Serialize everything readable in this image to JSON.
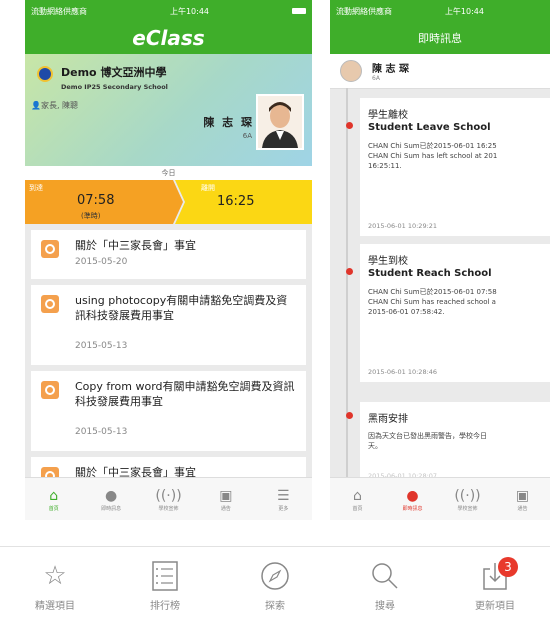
{
  "phone1": {
    "status": {
      "carrier": "流動網絡供應商",
      "time": "上午10:44"
    },
    "app_title": "eClass",
    "school": {
      "name_zh": "Demo 博文亞洲中學",
      "name_en": "Demo IP25 Secondary School"
    },
    "parent_label": "家長, 陳聰",
    "student": {
      "name": "陳 志 琛",
      "class": "6A"
    },
    "attendance": {
      "date_label": "今日",
      "arrive_label": "到達",
      "arrive_time": "07:58",
      "arrive_note": "(準時)",
      "leave_label": "離開",
      "leave_time": "16:25"
    },
    "notices": [
      {
        "title": "關於「中三家長會」事宜",
        "date": "2015-05-20"
      },
      {
        "title": "using photocopy有關申請豁免空調費及資訊科技發展費用事宜",
        "date": "2015-05-13"
      },
      {
        "title": "Copy from word有關申請豁免空調費及資訊科技發展費用事宜",
        "date": "2015-05-13"
      },
      {
        "title": "關於「中三家長會」事宜",
        "date": ""
      }
    ],
    "tabs": [
      {
        "label": "首頁",
        "icon": "home-icon"
      },
      {
        "label": "即時訊息",
        "icon": "chat-icon"
      },
      {
        "label": "學校宣佈",
        "icon": "broadcast-icon"
      },
      {
        "label": "通告",
        "icon": "notice-icon"
      },
      {
        "label": "更多",
        "icon": "menu-icon"
      }
    ]
  },
  "phone2": {
    "status": {
      "carrier": "流動網絡供應商",
      "time": "上午10:44"
    },
    "title": "即時訊息",
    "user": {
      "name": "陳 志 琛",
      "class": "6A"
    },
    "messages": [
      {
        "title_zh": "學生離校",
        "title_en": "Student Leave School",
        "body": "CHAN Chi Sum已於2015-06-01 16:25\nCHAN Chi Sum has left school at 201\n16:25:11.",
        "time": "2015-06-01 10:29:21"
      },
      {
        "title_zh": "學生到校",
        "title_en": "Student Reach School",
        "body": "CHAN Chi Sum已於2015-06-01 07:58\nCHAN Chi Sum has reached school a\n2015-06-01 07:58:42.",
        "time": "2015-06-01 10:28:46"
      },
      {
        "title_zh": "黑雨安排",
        "title_en": "",
        "body": "因為天文台已發出黑雨警告，學校今日\n天。",
        "time": "2015-06-01 10:28:07"
      }
    ],
    "tabs": [
      {
        "label": "首頁",
        "icon": "home-icon"
      },
      {
        "label": "即時訊息",
        "icon": "chat-icon"
      },
      {
        "label": "學校宣佈",
        "icon": "broadcast-icon"
      },
      {
        "label": "通告",
        "icon": "notice-icon"
      }
    ]
  },
  "dock": {
    "items": [
      {
        "label": "精選項目",
        "icon": "star-icon"
      },
      {
        "label": "排行榜",
        "icon": "list-icon"
      },
      {
        "label": "探索",
        "icon": "compass-icon"
      },
      {
        "label": "搜尋",
        "icon": "search-icon"
      },
      {
        "label": "更新項目",
        "icon": "download-icon",
        "badge": "3"
      }
    ]
  },
  "colors": {
    "brand_green": "#3fae2a",
    "arrive_orange": "#f5a123",
    "leave_yellow": "#fbd714",
    "alert_red": "#e0352b"
  }
}
